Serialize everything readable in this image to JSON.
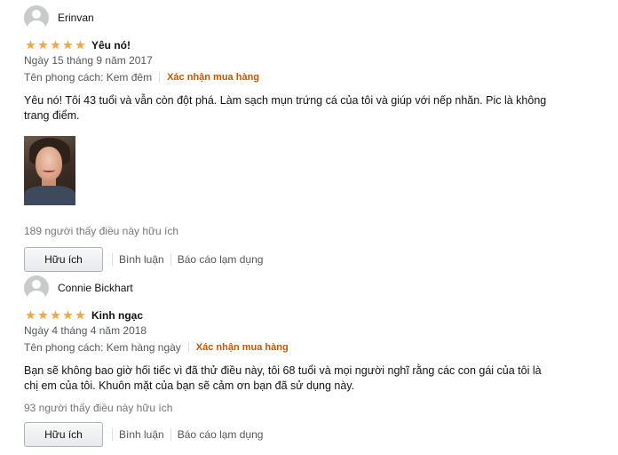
{
  "reviews": [
    {
      "reviewer": "Erinvan",
      "rating": 5,
      "title": "Yêu nó!",
      "date": "Ngày 15 tháng 9 năm 2017",
      "style": "Tên phong cách: Kem đêm",
      "verified": "Xác nhận mua hàng",
      "body": "Yêu nó! Tôi 43 tuổi và vẫn còn đột phá. Làm sạch mụn trứng cá của tôi và giúp với nếp nhăn. Pic là không trang điểm.",
      "helpful_count": "189 người thấy điều này hữu ích",
      "helpful_button": "Hữu ích",
      "comment_link": "Bình luận",
      "report_link": "Báo cáo lạm dụng"
    },
    {
      "reviewer": "Connie Bickhart",
      "rating": 5,
      "title": "Kinh ngạc",
      "date": "Ngày 4 tháng 4 năm 2018",
      "style": "Tên phong cách: Kem hàng ngày",
      "verified": "Xác nhận mua hàng",
      "body": "Bạn sẽ không bao giờ hối tiếc vì đã thử điều này, tôi 68 tuổi và mọi người nghĩ rằng các con gái của tôi là chị em của tôi. Khuôn mặt của bạn sẽ cảm ơn bạn đã sử dụng này.",
      "helpful_count": "93 người thấy điều này hữu ích",
      "helpful_button": "Hữu ích",
      "comment_link": "Bình luận",
      "report_link": "Báo cáo lạm dụng"
    }
  ],
  "colors": {
    "star": "#f3a847",
    "verified": "#c45500",
    "muted": "#565959"
  }
}
